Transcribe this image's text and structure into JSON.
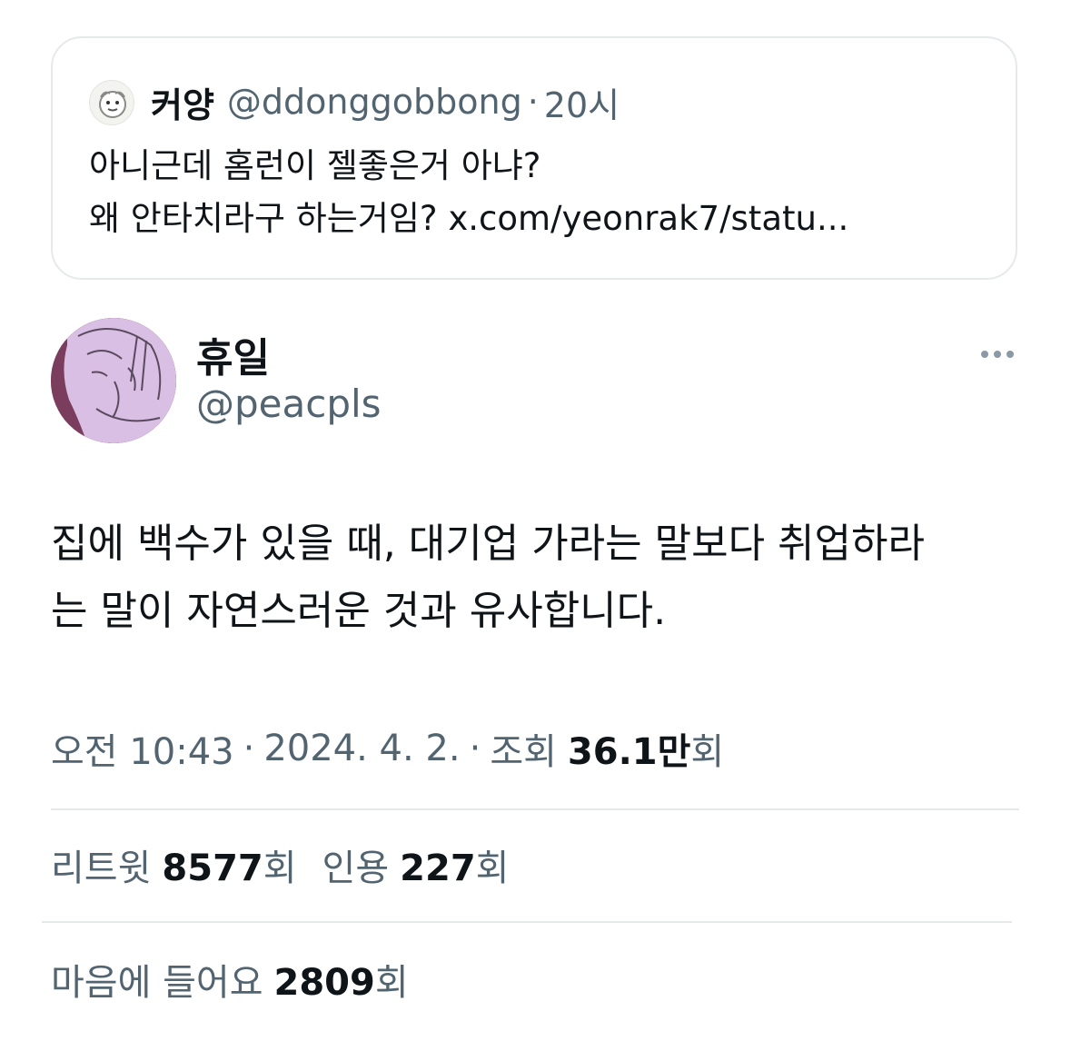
{
  "quoted_tweet": {
    "author_name": "커양",
    "author_handle": "@ddonggobbong",
    "separator": "·",
    "time": "20시",
    "text_lines": [
      "아니근데 홈런이 젤좋은거 아냐?",
      "왜 안타치라구 하는거임? x.com/yeonrak7/statu..."
    ]
  },
  "tweet": {
    "author_name": "휴일",
    "author_handle": "@peacpls",
    "more_icon": "ellipsis-icon",
    "text_lines": [
      "집에 백수가 있을 때, 대기업 가라는 말보다 취업하라",
      "는 말이 자연스러운 것과 유사합니다."
    ],
    "meta": {
      "time": "오전 10:43",
      "separator": "·",
      "date": "2024. 4. 2.",
      "views_label": "조회",
      "views_count": "36.1만",
      "views_suffix": "회"
    },
    "stats": {
      "retweets_label": "리트윗",
      "retweets_count": "8577",
      "retweets_suffix": "회",
      "quotes_label": "인용",
      "quotes_count": "227",
      "quotes_suffix": "회",
      "likes_label": "마음에 들어요",
      "likes_count": "2809",
      "likes_suffix": "회"
    }
  },
  "colors": {
    "text_primary": "#0f1419",
    "text_secondary": "#536471",
    "border": "#e6e9ec",
    "avatar_bg": "#7a3d5d",
    "avatar_art": "#d9bfe3"
  }
}
